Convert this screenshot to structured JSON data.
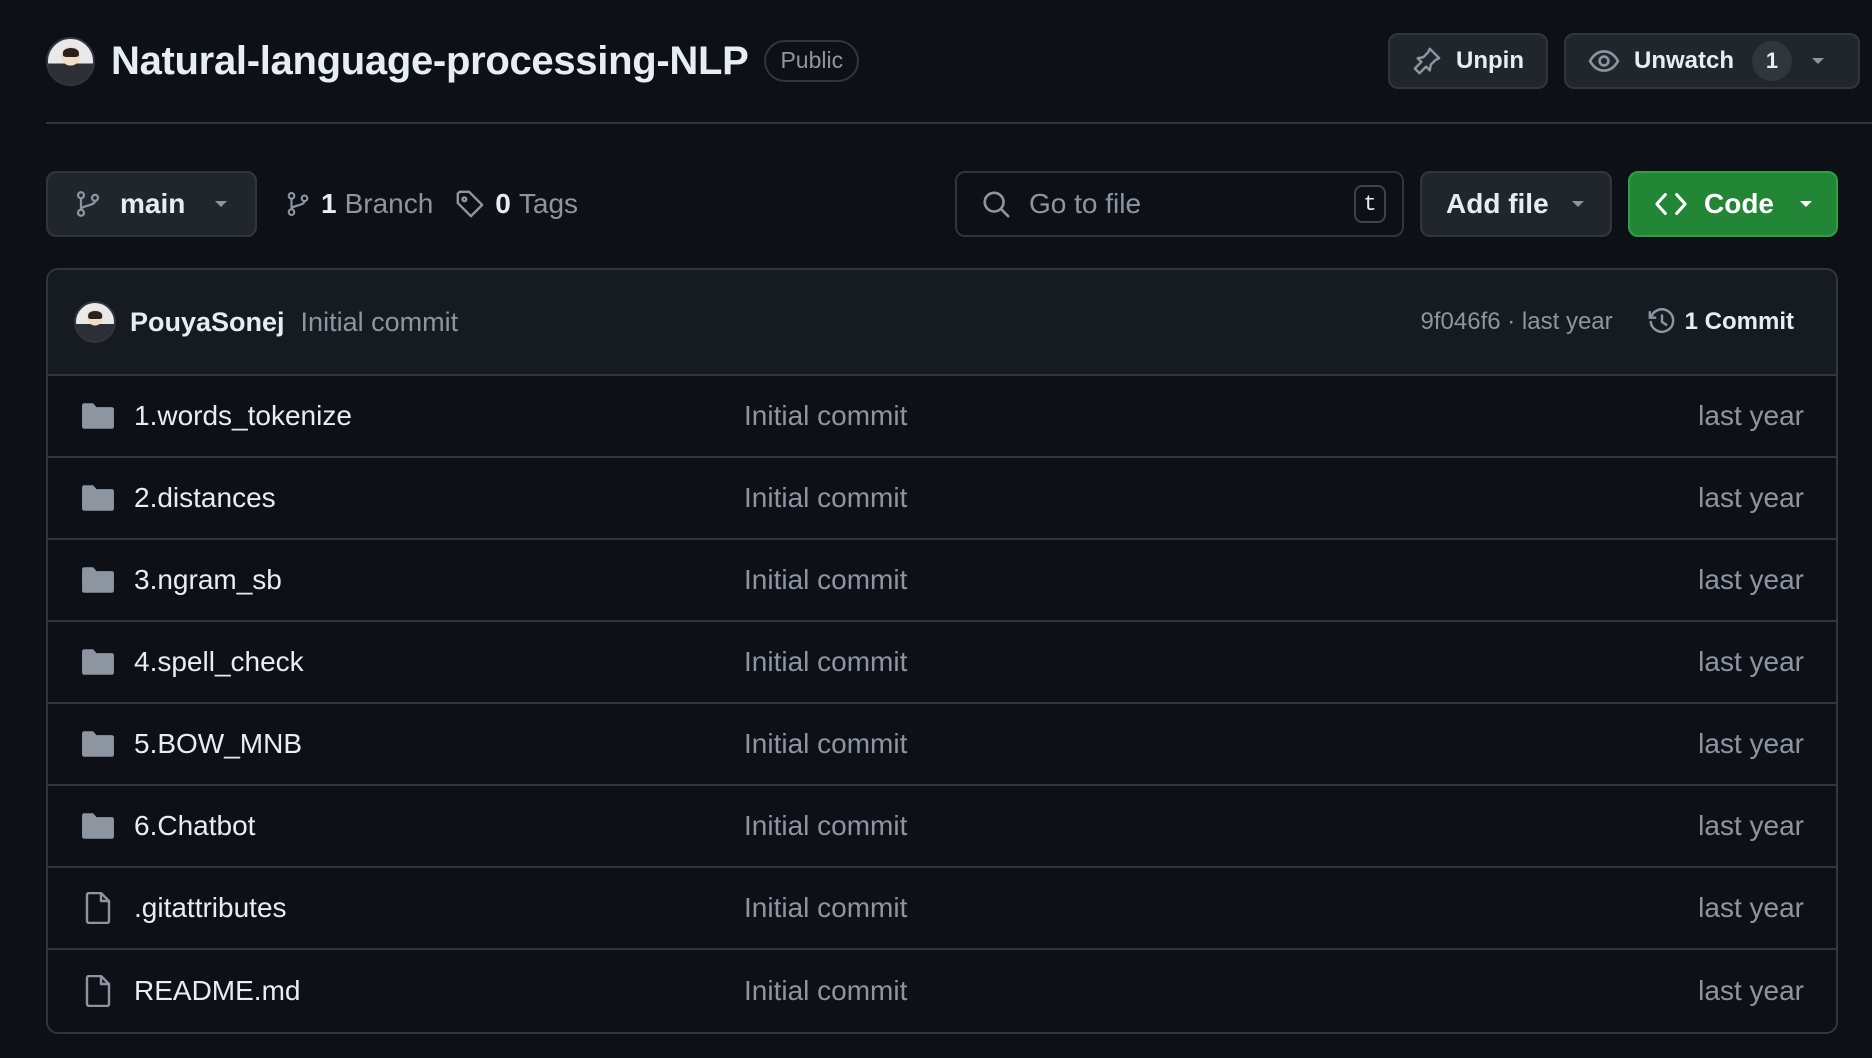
{
  "repo": {
    "name": "Natural-language-processing-NLP",
    "visibility": "Public"
  },
  "header_actions": {
    "unpin_label": "Unpin",
    "unwatch_label": "Unwatch",
    "watch_count": "1"
  },
  "toolbar": {
    "branch": "main",
    "branch_count": "1",
    "branch_label": "Branch",
    "tag_count": "0",
    "tag_label": "Tags",
    "search_placeholder": "Go to file",
    "search_shortcut": "t",
    "add_file_label": "Add file",
    "code_label": "Code"
  },
  "latest_commit": {
    "author": "PouyaSonej",
    "message": "Initial commit",
    "meta": "9f046f6 · last year",
    "count_label": "1 Commit"
  },
  "files": [
    {
      "type": "folder",
      "icon": "folder-icon",
      "name": "1.words_tokenize",
      "message": "Initial commit",
      "date": "last year"
    },
    {
      "type": "folder",
      "icon": "folder-icon",
      "name": "2.distances",
      "message": "Initial commit",
      "date": "last year"
    },
    {
      "type": "folder",
      "icon": "folder-icon",
      "name": "3.ngram_sb",
      "message": "Initial commit",
      "date": "last year"
    },
    {
      "type": "folder",
      "icon": "folder-icon",
      "name": "4.spell_check",
      "message": "Initial commit",
      "date": "last year"
    },
    {
      "type": "folder",
      "icon": "folder-icon",
      "name": "5.BOW_MNB",
      "message": "Initial commit",
      "date": "last year"
    },
    {
      "type": "folder",
      "icon": "folder-icon",
      "name": "6.Chatbot",
      "message": "Initial commit",
      "date": "last year"
    },
    {
      "type": "file",
      "icon": "file-icon",
      "name": ".gitattributes",
      "message": "Initial commit",
      "date": "last year"
    },
    {
      "type": "file",
      "icon": "file-icon",
      "name": "README.md",
      "message": "Initial commit",
      "date": "last year"
    }
  ],
  "colors": {
    "background": "#0d1117",
    "border": "#30363d",
    "code_button": "#238636",
    "muted_text": "#8d96a0"
  }
}
